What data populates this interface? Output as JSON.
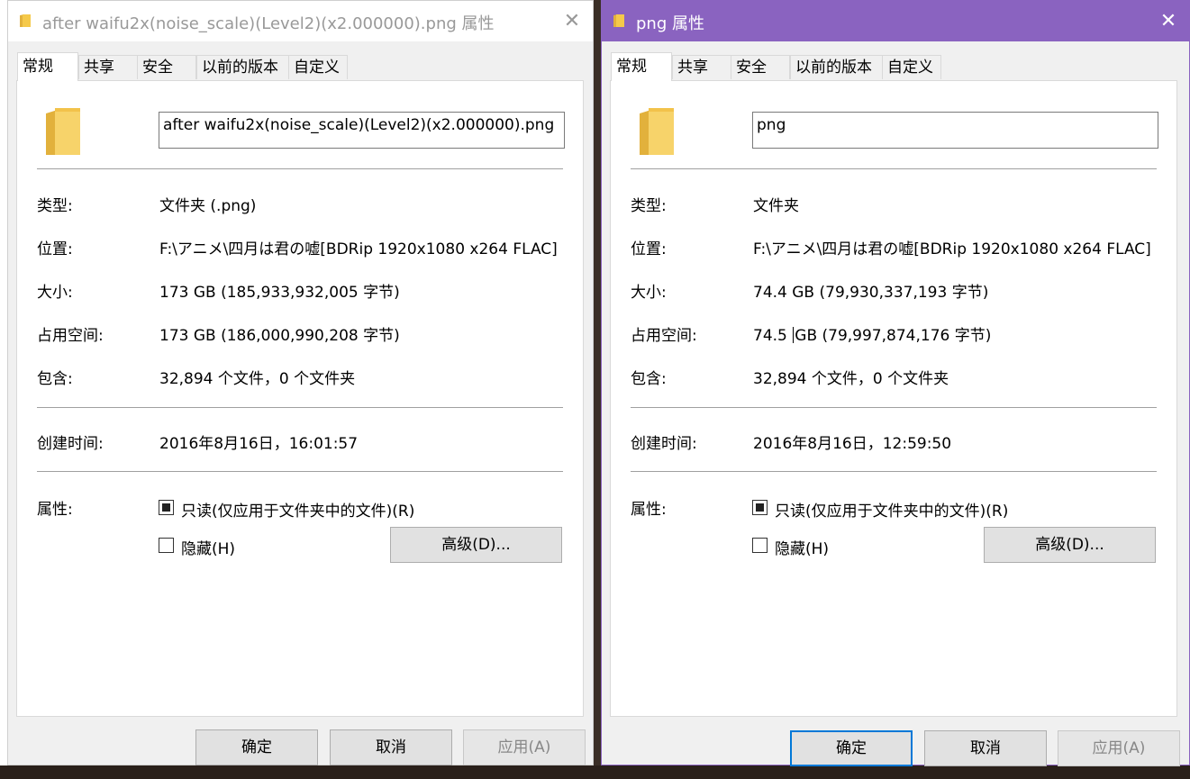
{
  "left_dialog": {
    "title": "after waifu2x(noise_scale)(Level2)(x2.000000).png 属性",
    "close_glyph": "✕",
    "tabs": [
      "常规",
      "共享",
      "安全",
      "以前的版本",
      "自定义"
    ],
    "name_value": "after waifu2x(noise_scale)(Level2)(x2.000000).png",
    "type_label": "类型:",
    "type_value": "文件夹 (.png)",
    "location_label": "位置:",
    "location_value": "F:\\アニメ\\四月は君の嘘[BDRip 1920x1080 x264 FLAC]",
    "size_label": "大小:",
    "size_value": "173 GB (185,933,932,005 字节)",
    "disk_label": "占用空间:",
    "disk_value": "173 GB (186,000,990,208 字节)",
    "contains_label": "包含:",
    "contains_value": "32,894 个文件，0 个文件夹",
    "created_label": "创建时间:",
    "created_value": "2016年8月16日，16:01:57",
    "attr_label": "属性:",
    "readonly_label": "只读(仅应用于文件夹中的文件)(R)",
    "hidden_label": "隐藏(H)",
    "advanced_button": "高级(D)...",
    "ok_button": "确定",
    "cancel_button": "取消",
    "apply_button": "应用(A)"
  },
  "right_dialog": {
    "title": "png 属性",
    "close_glyph": "✕",
    "tabs": [
      "常规",
      "共享",
      "安全",
      "以前的版本",
      "自定义"
    ],
    "name_value": "png",
    "type_label": "类型:",
    "type_value": "文件夹",
    "location_label": "位置:",
    "location_value": "F:\\アニメ\\四月は君の嘘[BDRip 1920x1080 x264 FLAC]",
    "size_label": "大小:",
    "size_value": "74.4 GB (79,930,337,193 字节)",
    "disk_label": "占用空间:",
    "disk_value_a": "74.5",
    "disk_value_b": "GB (79,997,874,176 字节)",
    "contains_label": "包含:",
    "contains_value": "32,894 个文件，0 个文件夹",
    "created_label": "创建时间:",
    "created_value": "2016年8月16日，12:59:50",
    "attr_label": "属性:",
    "readonly_label": "只读(仅应用于文件夹中的文件)(R)",
    "hidden_label": "隐藏(H)",
    "advanced_button": "高级(D)...",
    "ok_button": "确定",
    "cancel_button": "取消",
    "apply_button": "应用(A)"
  },
  "colors": {
    "active_title_bar": "#8a63c0",
    "inactive_title_bar": "#ffffff",
    "folder_yellow": "#f5c94a",
    "primary_button_border": "#0078d7"
  },
  "icons": [
    "folder-icon",
    "close-icon"
  ],
  "checkbox_state": {
    "readonly": "indeterminate",
    "hidden": "unchecked"
  }
}
